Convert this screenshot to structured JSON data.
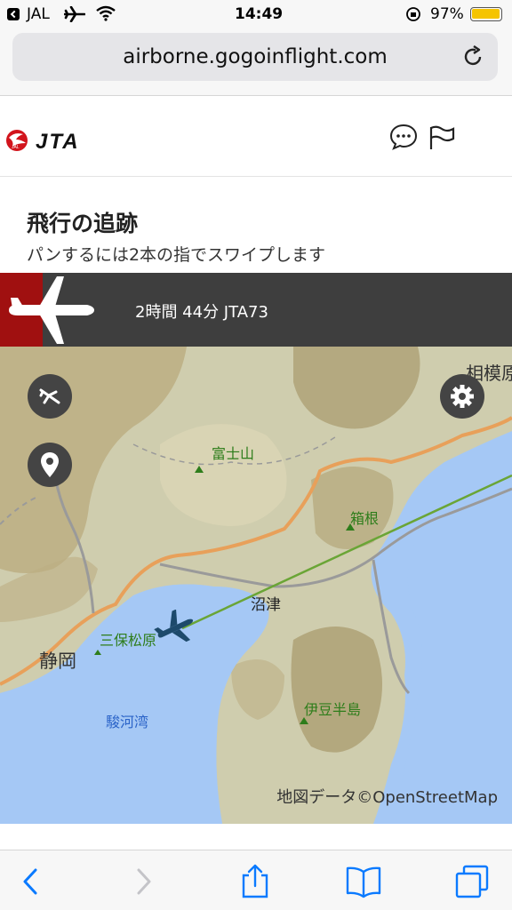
{
  "status_bar": {
    "carrier": "JAL",
    "time": "14:49",
    "battery": "97%",
    "icons": [
      "back-to-app-icon",
      "airplane-mode-icon",
      "wifi-icon",
      "rotation-lock-icon",
      "battery-icon"
    ]
  },
  "browser": {
    "url": "airborne.gogoinflight.com",
    "reload_icon": "reload-icon"
  },
  "header": {
    "brand": "JTA",
    "icons": [
      "jal-crane-logo",
      "chat-icon",
      "flag-icon"
    ]
  },
  "page": {
    "title": "飛行の追跡",
    "subtitle": "パンするには2本の指でスワイプします"
  },
  "flight": {
    "info": "2時間 44分  JTA73",
    "icon": "airplane-icon"
  },
  "map": {
    "labels": {
      "fuji": "富士山",
      "hakone": "箱根",
      "numazu": "沼津",
      "miho": "三保松原",
      "shizuoka": "静岡",
      "suruga": "駿河湾",
      "izu": "伊豆半島",
      "sagami": "相模原"
    },
    "credit": "地図データ©OpenStreetMap",
    "buttons": [
      "flight-mode-icon",
      "location-pin-icon",
      "settings-gear-icon"
    ],
    "colors": {
      "water": "#a5c8f5",
      "land": "#c8c7a6",
      "highway": "#e8a05a",
      "route": "#6aa536",
      "plane": "#1d4a6b"
    }
  },
  "toolbar": {
    "icons": [
      "back-arrow-icon",
      "forward-arrow-icon",
      "share-icon",
      "bookmarks-icon",
      "tabs-icon"
    ]
  }
}
